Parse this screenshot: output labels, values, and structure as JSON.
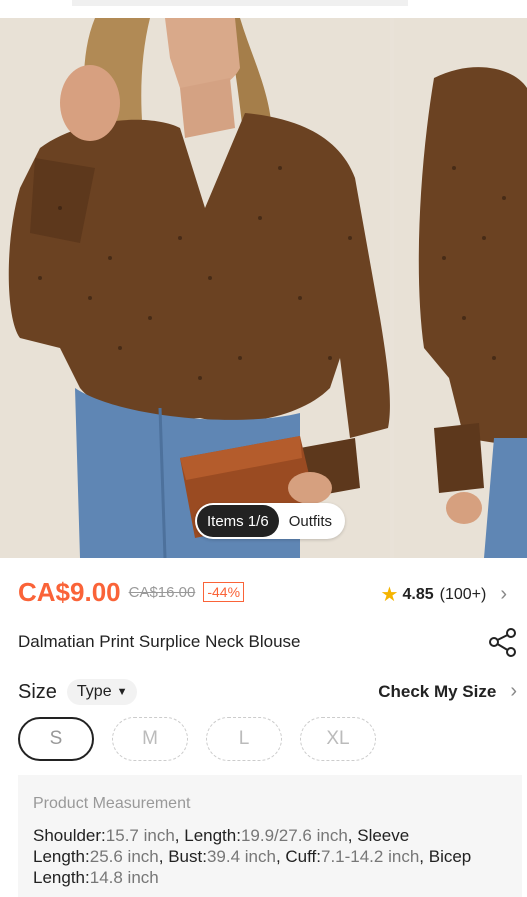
{
  "gallery": {
    "items_label": "Items 1/6",
    "outfits_label": "Outfits"
  },
  "price": {
    "current": "CA$9.00",
    "original": "CA$16.00",
    "discount": "-44%"
  },
  "rating": {
    "value": "4.85",
    "count": "(100+)"
  },
  "product": {
    "title": "Dalmatian Print Surplice Neck Blouse"
  },
  "size": {
    "label": "Size",
    "type_label": "Type",
    "check_label": "Check My Size",
    "options": [
      "S",
      "M",
      "L",
      "XL"
    ],
    "selected": "S"
  },
  "measurement": {
    "title": "Product Measurement",
    "items": [
      {
        "label": "Shoulder:",
        "value": "15.7 inch"
      },
      {
        "label": "Length:",
        "value": "19.9/27.6 inch"
      },
      {
        "label": "Sleeve Length:",
        "value": "25.6 inch"
      },
      {
        "label": "Bust:",
        "value": "39.4 inch"
      },
      {
        "label": "Cuff:",
        "value": "7.1-14.2 inch"
      },
      {
        "label": "Bicep Length:",
        "value": "14.8 inch"
      }
    ]
  },
  "colors": {
    "accent": "#fa6338",
    "star": "#f5b400",
    "blouse": "#6b4222"
  },
  "icons": {
    "star": "star-icon",
    "share": "share-icon",
    "chevron": "chevron-right-icon"
  }
}
